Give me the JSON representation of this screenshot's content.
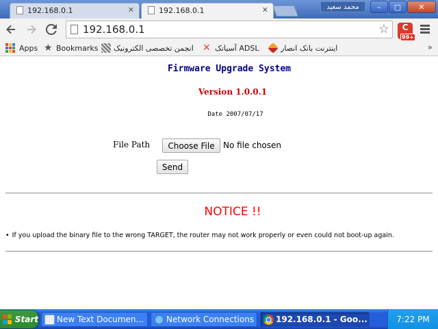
{
  "browser": {
    "tabs": [
      {
        "title": "192.168.0.1",
        "active": false
      },
      {
        "title": "192.168.0.1",
        "active": true
      }
    ],
    "profile_name": "محمد سعید",
    "window_controls": {
      "minimize": "–",
      "maximize": "▢",
      "close": "✕"
    },
    "url": "192.168.0.1",
    "extension_badge": {
      "letter": "C",
      "count": "99+"
    },
    "bookmarks": [
      {
        "label": "Apps",
        "icon": "apps-grid-icon"
      },
      {
        "label": "Bookmarks",
        "icon": "star-icon"
      },
      {
        "label": "انجمن تخصصی الکترونیک",
        "icon": "electronics-icon"
      },
      {
        "label": "آسیاتک ADSL",
        "icon": "asiatech-icon"
      },
      {
        "label": "اینترنت بانک انصار",
        "icon": "bank-ansar-icon"
      }
    ],
    "bookmarks_more": "»"
  },
  "page": {
    "title": "Firmware Upgrade System",
    "version": "Version 1.0.0.1",
    "date": "Date 2007/07/17",
    "file_path_label": "File Path",
    "choose_file_label": "Choose File",
    "no_file_text": "No file chosen",
    "send_label": "Send",
    "notice_title": "NOTICE !!",
    "notice_bullet": "•",
    "notice_text": "If you upload the binary file to the wrong TARGET, the router may not work properly or even could not boot-up again."
  },
  "taskbar": {
    "start_label": "Start",
    "tasks": [
      {
        "label": "New Text Documen...",
        "icon": "notepad-icon",
        "active": false
      },
      {
        "label": "Network Connections",
        "icon": "network-icon",
        "active": false
      },
      {
        "label": "192.168.0.1 - Goo...",
        "icon": "chrome-icon",
        "active": true
      }
    ],
    "clock": "7:22 PM"
  },
  "colors": {
    "title_blue": "#000080",
    "version_red": "#cc0000",
    "notice_red": "#ff0000",
    "taskbar_blue": "#245edb",
    "start_green": "#2f8a2f"
  }
}
